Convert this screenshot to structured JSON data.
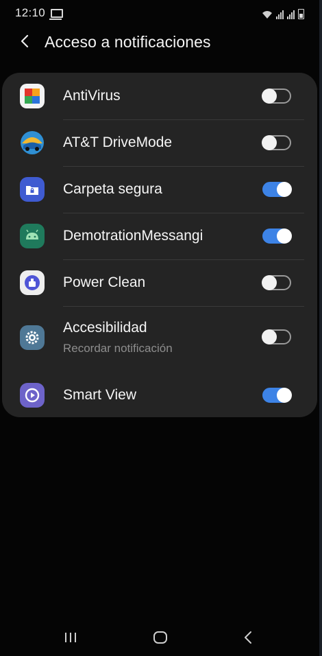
{
  "status_bar": {
    "time": "12:10",
    "icons": [
      "screen-cast-icon",
      "wifi-icon",
      "signal-icon",
      "signal-icon",
      "battery-icon"
    ]
  },
  "header": {
    "title": "Acceso a notificaciones",
    "back_icon": "back-arrow-icon"
  },
  "apps": [
    {
      "label": "AntiVirus",
      "enabled": false,
      "icon": "antivirus-icon"
    },
    {
      "label": "AT&T DriveMode",
      "enabled": false,
      "icon": "drivemode-icon"
    },
    {
      "label": "Carpeta segura",
      "enabled": true,
      "icon": "secure-folder-icon"
    },
    {
      "label": "DemotrationMessangi",
      "enabled": true,
      "icon": "android-icon"
    },
    {
      "label": "Power Clean",
      "enabled": false,
      "icon": "power-clean-icon"
    },
    {
      "label": "Accesibilidad",
      "sublabel": "Recordar notificación",
      "enabled": false,
      "icon": "settings-gear-icon"
    },
    {
      "label": "Smart View",
      "enabled": true,
      "icon": "smart-view-icon"
    }
  ],
  "nav_bar": {
    "icons": [
      "recents-icon",
      "home-icon",
      "back-icon"
    ]
  },
  "colors": {
    "accent": "#3d83e6",
    "card": "#242424",
    "background": "#050505"
  }
}
